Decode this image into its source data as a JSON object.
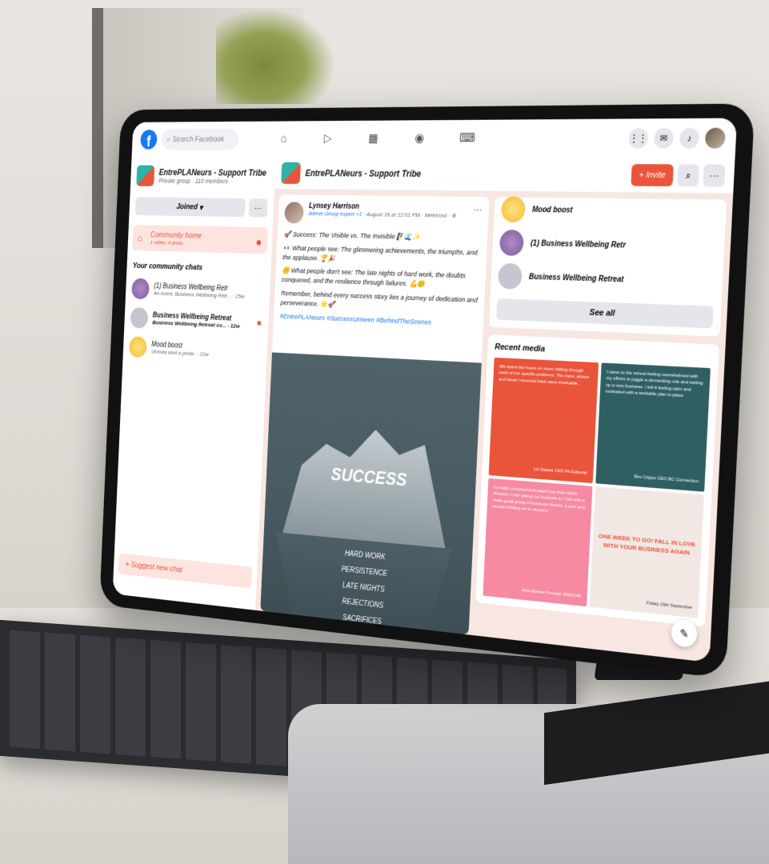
{
  "topbar": {
    "logo": "f",
    "search_placeholder": "Search Facebook",
    "nav_icons": [
      "home-icon",
      "video-icon",
      "marketplace-icon",
      "groups-icon",
      "gaming-icon"
    ]
  },
  "group": {
    "name": "EntrePLANeurs - Support Tribe",
    "privacy": "Private group · 110 members",
    "joined_label": "Joined",
    "invite_label": "+ Invite"
  },
  "sidebar": {
    "community_home": {
      "title": "Community home",
      "sub": "1 video, 4 posts"
    },
    "chats_title": "Your community chats",
    "chats": [
      {
        "title": "(1) Business Wellbeing Retr",
        "sub": "An event, Business Wellbeing Retr... · 25w"
      },
      {
        "title": "Business Wellbeing Retreat",
        "sub": "Business Wellbeing Retreat co... · 12w"
      },
      {
        "title": "Mood boost",
        "sub": "Victoria sent a photo. · 22w"
      }
    ],
    "suggest_label": "+ Suggest new chat"
  },
  "post": {
    "author": "Lynsey Harrison",
    "meta_roles": "Admin  Group expert  +1",
    "meta_time": " · August 16 at 12:01 PM · Metricool · ⊕",
    "lines": [
      "🚀 Success: The Visible vs. The Invisible 🧗‍♀️🌊✨",
      "👀 What people see: The glimmering achievements, the triumphs, and the applause. 🏆🎉",
      "🤫 What people don't see: The late nights of hard work, the doubts conquered, and the resilience through failures. 💪😊",
      "Remember, behind every success story lies a journey of dedication and perseverance. 🌟🚀"
    ],
    "tags": "#EntrePLANeurs #SuccessUnseen #BehindTheScenes",
    "image_title": "SUCCESS",
    "image_words": [
      "HARD WORK",
      "PERSISTENCE",
      "LATE NIGHTS",
      "REJECTIONS",
      "SACRIFICES"
    ]
  },
  "right": {
    "partial_item": "Mood boost",
    "items": [
      "(1) Business Wellbeing Retr",
      "Business Wellbeing Retreat"
    ],
    "see_all": "See all",
    "media_title": "Recent media",
    "tiles": [
      {
        "text": "We spent two hours on zoom talking through each of our specific problems. The input, advice and ideas I received back were invaluable.",
        "sig": "Liz Dawes\nCEO PA Editorial"
      },
      {
        "text": "I came to the retreat feeling overwhelmed with my efforts to juggle a demanding role and setting up a new business. I left it feeling calm and motivated with a workable plan in place.",
        "sig": "Bev Cripps\nCEO BC Connection"
      },
      {
        "text": "I'd really confused and wasn't too sure which direction I was taking my business in. I left with a really great group of business friends, a plan and people holding me to account.",
        "sig": "Jess Brewer\nFounder EMIZ HR"
      },
      {
        "text": "ONE WEEK TO GO! FALL IN LOVE WITH YOUR BUSINESS AGAIN",
        "sig": "Friday 15th September"
      }
    ]
  }
}
